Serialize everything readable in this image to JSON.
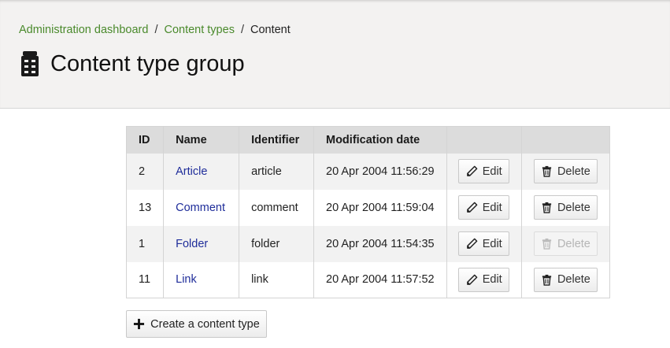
{
  "breadcrumb": {
    "items": [
      "Administration dashboard",
      "Content types"
    ],
    "separator": "/",
    "current": "Content"
  },
  "page": {
    "title": "Content type group",
    "icon": "content-type-group-icon"
  },
  "table": {
    "headers": [
      "ID",
      "Name",
      "Identifier",
      "Modification date",
      "",
      ""
    ],
    "edit_label": "Edit",
    "delete_label": "Delete",
    "rows": [
      {
        "id": "2",
        "name": "Article",
        "identifier": "article",
        "date": "20 Apr 2004 11:56:29",
        "delete_enabled": true
      },
      {
        "id": "13",
        "name": "Comment",
        "identifier": "comment",
        "date": "20 Apr 2004 11:59:04",
        "delete_enabled": true
      },
      {
        "id": "1",
        "name": "Folder",
        "identifier": "folder",
        "date": "20 Apr 2004 11:54:35",
        "delete_enabled": false
      },
      {
        "id": "11",
        "name": "Link",
        "identifier": "link",
        "date": "20 Apr 2004 11:57:52",
        "delete_enabled": true
      }
    ]
  },
  "actions": {
    "create_label": "Create a content type"
  },
  "colors": {
    "link_green": "#4a8a2c",
    "link_blue": "#1f2d9a",
    "header_bg": "#f3f2f1"
  }
}
